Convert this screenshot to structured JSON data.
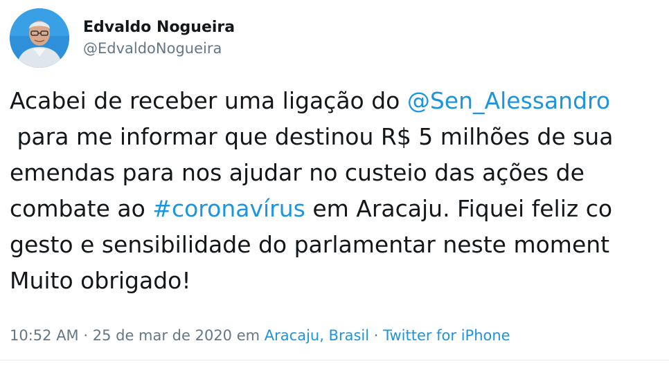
{
  "author": {
    "display_name": "Edvaldo Nogueira",
    "handle": "@EdvaldoNogueira"
  },
  "tweet": {
    "line1_prefix": "Acabei de receber uma ligação do ",
    "mention": "@Sen_Alessandro",
    "line2": " para me informar que destinou R$ 5 milhões de sua",
    "line3": "emendas para nos ajudar no custeio das ações de",
    "line4_prefix": "combate ao ",
    "hashtag": "#coronavírus",
    "line4_suffix": " em Aracaju. Fiquei feliz co",
    "line5": "gesto e sensibilidade do parlamentar neste moment",
    "line6": "Muito obrigado!"
  },
  "meta": {
    "time": "10:52 AM",
    "sep1": " · ",
    "date": "25 de mar de 2020",
    "em": " em ",
    "location": "Aracaju, Brasil",
    "sep2": " · ",
    "source": "Twitter for iPhone"
  },
  "colors": {
    "link": "#1b95e0",
    "secondary_text": "#657786",
    "primary_text": "#14171a"
  },
  "icons": {
    "avatar": "profile-photo"
  }
}
